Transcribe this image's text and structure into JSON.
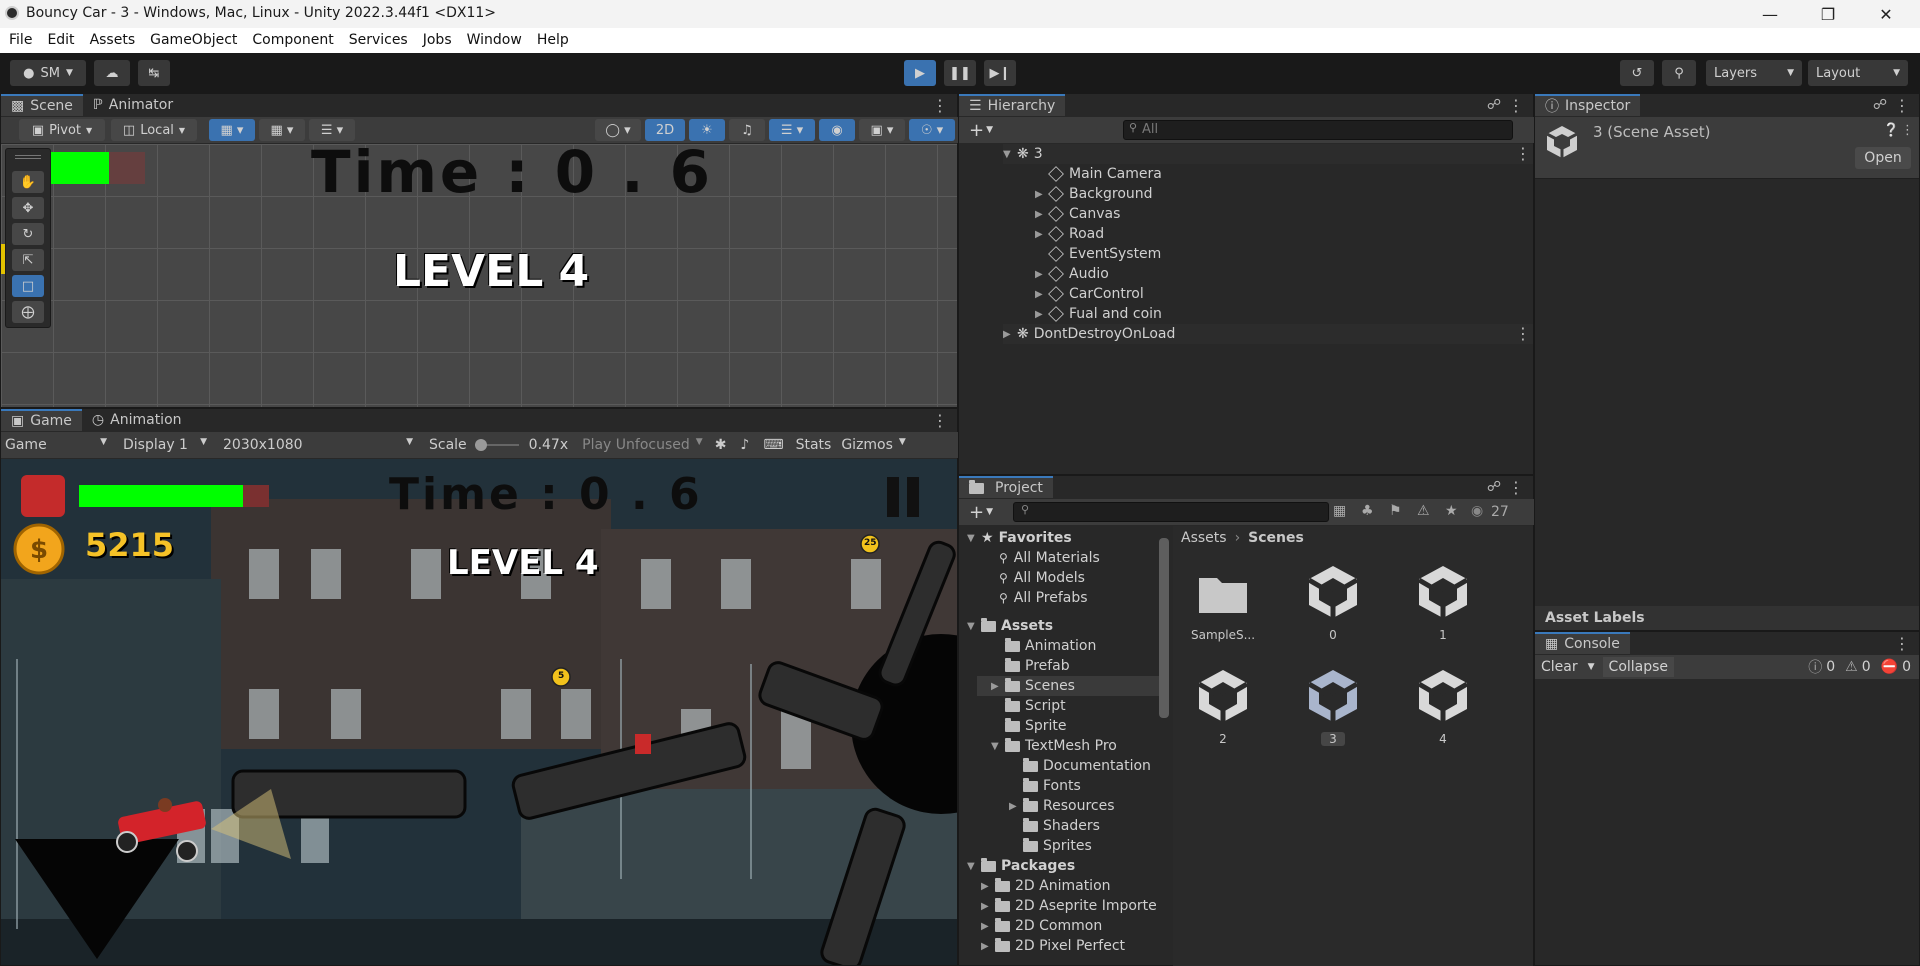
{
  "window": {
    "title": "Bouncy Car - 3 - Windows, Mac, Linux - Unity 2022.3.44f1 <DX11>"
  },
  "menu": [
    "File",
    "Edit",
    "Assets",
    "GameObject",
    "Component",
    "Services",
    "Jobs",
    "Window",
    "Help"
  ],
  "toolbar": {
    "account": "SM",
    "layers": "Layers",
    "layout": "Layout"
  },
  "scene_panel": {
    "tabs": [
      "Scene",
      "Animator"
    ],
    "pivot": "Pivot",
    "local": "Local",
    "mode_2d": "2D",
    "time_text": "Time : 0 . 6",
    "level_text": "LEVEL 4"
  },
  "game_panel": {
    "tabs": [
      "Game",
      "Animation"
    ],
    "game_dropdown": "Game",
    "display": "Display 1",
    "resolution": "2030x1080",
    "scale_label": "Scale",
    "scale_value": "0.47x",
    "play_mode": "Play Unfocused",
    "stats": "Stats",
    "gizmos": "Gizmos",
    "coins": "5215",
    "time_text": "Time : 0 . 6",
    "level_text": "LEVEL 4",
    "coin_a": "25",
    "coin_b": "5",
    "fuel_fraction": 0.82
  },
  "hierarchy": {
    "title": "Hierarchy",
    "search_placeholder": "All",
    "scene": "3",
    "items": [
      "Main Camera",
      "Background",
      "Canvas",
      "Road",
      "EventSystem",
      "Audio",
      "CarControl",
      "Fual and coin"
    ],
    "ddol": "DontDestroyOnLoad"
  },
  "inspector": {
    "title": "Inspector",
    "asset_name": "3 (Scene Asset)",
    "open": "Open",
    "asset_labels": "Asset Labels"
  },
  "console": {
    "title": "Console",
    "clear": "Clear",
    "collapse": "Collapse",
    "errors": "0",
    "warnings": "0",
    "infos": "0"
  },
  "project": {
    "title": "Project",
    "count": "27",
    "favorites_title": "Favorites",
    "favorites": [
      "All Materials",
      "All Models",
      "All Prefabs"
    ],
    "assets_title": "Assets",
    "assets": [
      "Animation",
      "Prefab",
      "Scenes",
      "Script",
      "Sprite",
      "TextMesh Pro"
    ],
    "textmesh": [
      "Documentation",
      "Fonts",
      "Resources",
      "Shaders",
      "Sprites"
    ],
    "packages_title": "Packages",
    "packages": [
      "2D Animation",
      "2D Aseprite Importe",
      "2D Common",
      "2D Pixel Perfect"
    ],
    "breadcrumb": [
      "Assets",
      "Scenes"
    ],
    "grid_items": [
      "SampleS...",
      "0",
      "1",
      "2",
      "3",
      "4"
    ]
  }
}
